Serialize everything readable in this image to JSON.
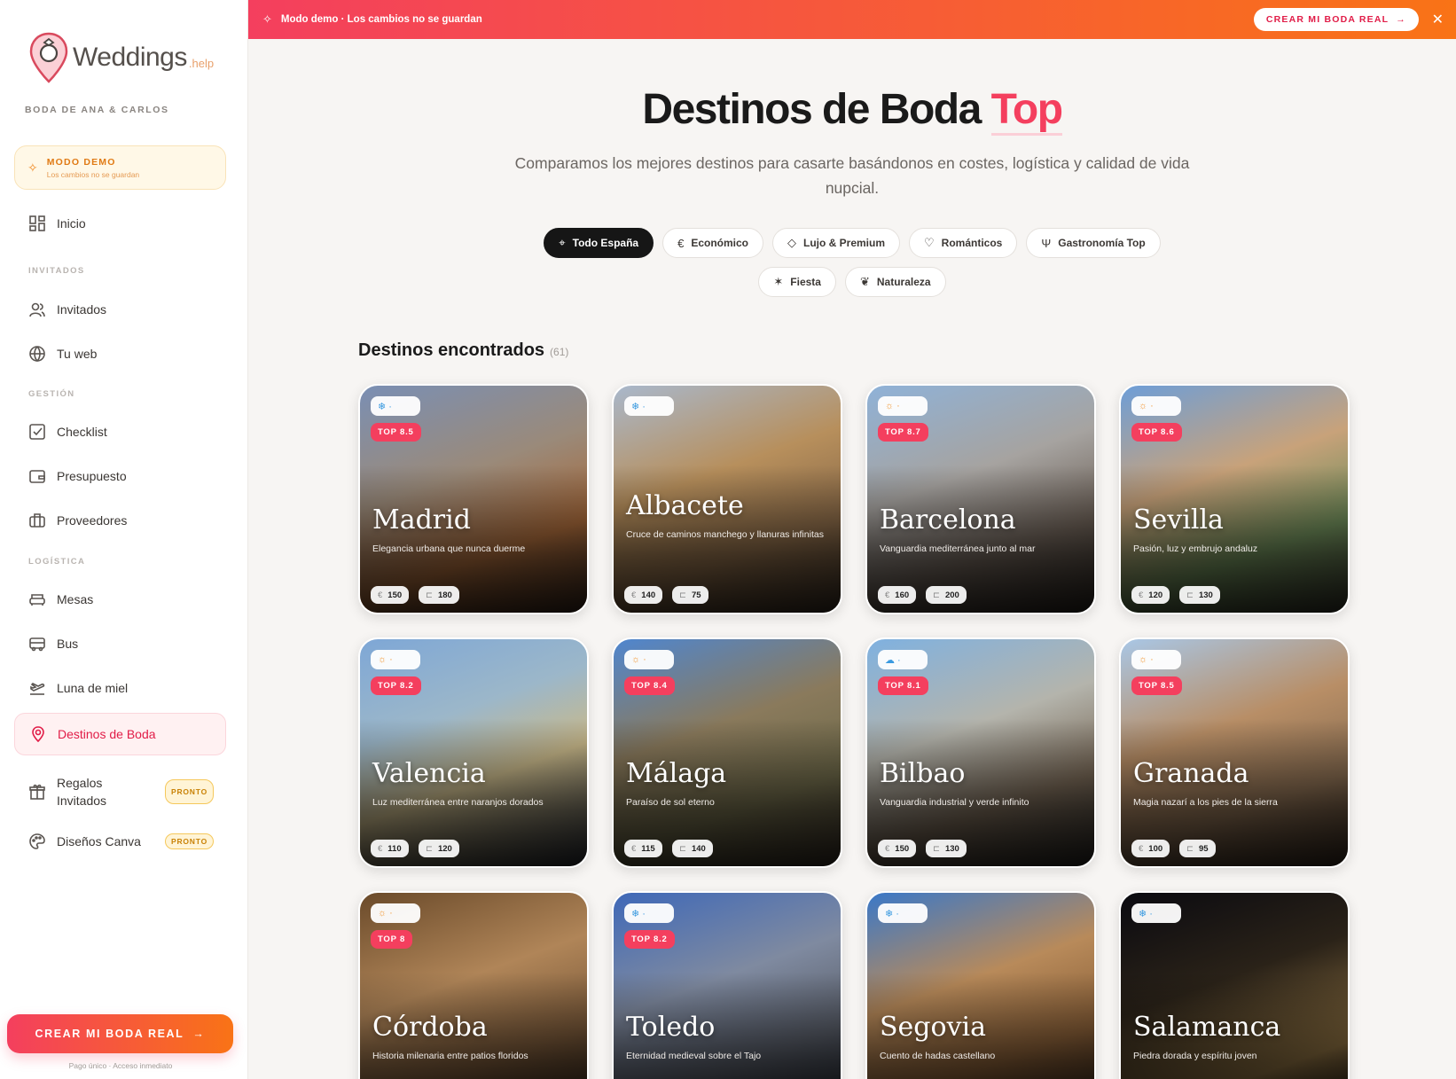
{
  "brand": {
    "name": "Weddings",
    "suffix": ".help"
  },
  "wedding_name": "BODA DE ANA & CARLOS",
  "demo_box": {
    "title": "MODO DEMO",
    "subtitle": "Los cambios no se guardan"
  },
  "nav": {
    "inicio": "Inicio",
    "section_invitados": "INVITADOS",
    "invitados": "Invitados",
    "tu_web": "Tu web",
    "section_gestion": "GESTIÓN",
    "checklist": "Checklist",
    "presupuesto": "Presupuesto",
    "proveedores": "Proveedores",
    "section_logistica": "LOGÍSTICA",
    "mesas": "Mesas",
    "bus": "Bus",
    "luna": "Luna de miel",
    "destinos": "Destinos de Boda",
    "regalos_1": "Regalos",
    "regalos_2": "Invitados",
    "disenos": "Diseños Canva",
    "pronto": "PRONTO"
  },
  "cta": {
    "label": "CREAR MI BODA REAL",
    "note": "Pago único · Acceso inmediato"
  },
  "banner": {
    "text": "Modo demo · Los cambios no se guardan",
    "button": "CREAR MI BODA REAL"
  },
  "hero": {
    "title_main": "Destinos de Boda ",
    "title_accent": "Top",
    "subtitle": "Comparamos los mejores destinos para casarte basándonos en costes, logística y calidad de vida nupcial."
  },
  "filters": [
    "Todo España",
    "Económico",
    "Lujo & Premium",
    "Románticos",
    "Gastronomía Top",
    "Fiesta",
    "Naturaleza"
  ],
  "results": {
    "title": "Destinos encontrados",
    "count": "(61)"
  },
  "cards": [
    {
      "city": "Madrid",
      "tagline": "Elegancia urbana que nunca duerme",
      "top": "TOP 8.5",
      "weather": "cold",
      "cost": "150",
      "beds": "180"
    },
    {
      "city": "Albacete",
      "tagline": "Cruce de caminos manchego y llanuras infinitas",
      "top": "",
      "weather": "cold",
      "cost": "140",
      "beds": "75"
    },
    {
      "city": "Barcelona",
      "tagline": "Vanguardia mediterránea junto al mar",
      "top": "TOP 8.7",
      "weather": "sun",
      "cost": "160",
      "beds": "200"
    },
    {
      "city": "Sevilla",
      "tagline": "Pasión, luz y embrujo andaluz",
      "top": "TOP 8.6",
      "weather": "sun",
      "cost": "120",
      "beds": "130"
    },
    {
      "city": "Valencia",
      "tagline": "Luz mediterránea entre naranjos dorados",
      "top": "TOP 8.2",
      "weather": "sun",
      "cost": "110",
      "beds": "120"
    },
    {
      "city": "Málaga",
      "tagline": "Paraíso de sol eterno",
      "top": "TOP 8.4",
      "weather": "sun",
      "cost": "115",
      "beds": "140"
    },
    {
      "city": "Bilbao",
      "tagline": "Vanguardia industrial y verde infinito",
      "top": "TOP 8.1",
      "weather": "cloud",
      "cost": "150",
      "beds": "130"
    },
    {
      "city": "Granada",
      "tagline": "Magia nazarí a los pies de la sierra",
      "top": "TOP 8.5",
      "weather": "sun",
      "cost": "100",
      "beds": "95"
    },
    {
      "city": "Córdoba",
      "tagline": "Historia milenaria entre patios floridos",
      "top": "TOP 8",
      "weather": "sun",
      "cost": "",
      "beds": ""
    },
    {
      "city": "Toledo",
      "tagline": "Eternidad medieval sobre el Tajo",
      "top": "TOP 8.2",
      "weather": "cold",
      "cost": "",
      "beds": ""
    },
    {
      "city": "Segovia",
      "tagline": "Cuento de hadas castellano",
      "top": "",
      "weather": "cold",
      "cost": "",
      "beds": ""
    },
    {
      "city": "Salamanca",
      "tagline": "Piedra dorada y espíritu joven",
      "top": "",
      "weather": "cold",
      "cost": "",
      "beds": ""
    }
  ]
}
